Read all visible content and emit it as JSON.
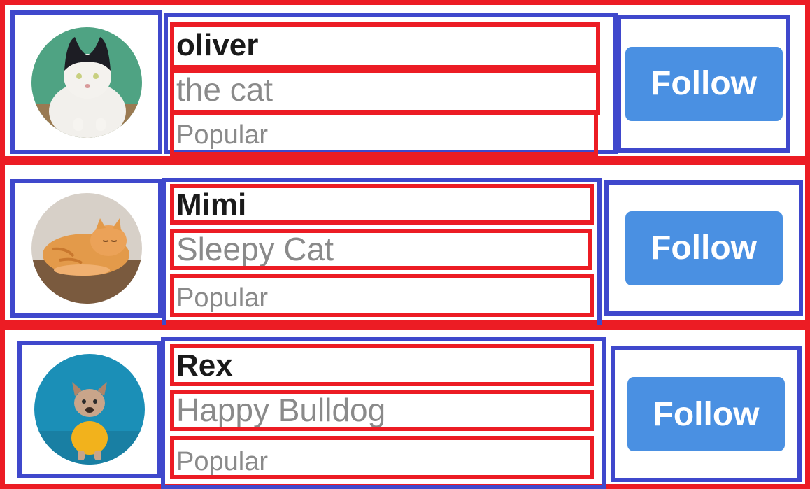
{
  "theme": {
    "accent": "#4a90e2",
    "outer_border": "#ec1c24",
    "inner_border": "#3f48cc",
    "name_color": "#1a1a1a",
    "muted_color": "#8a8a8a"
  },
  "users": [
    {
      "name": "oliver",
      "subtitle": "the cat",
      "badge": "Popular",
      "avatar": "cat-black-white-photo",
      "follow_label": "Follow"
    },
    {
      "name": "Mimi",
      "subtitle": "Sleepy Cat",
      "badge": "Popular",
      "avatar": "cat-orange-sleeping-photo",
      "follow_label": "Follow"
    },
    {
      "name": "Rex",
      "subtitle": "Happy Bulldog",
      "badge": "Popular",
      "avatar": "french-bulldog-yellow-shirt-photo",
      "follow_label": "Follow"
    }
  ]
}
